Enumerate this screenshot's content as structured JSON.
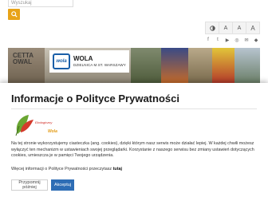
{
  "header": {
    "search": {
      "placeholder": "Wyszukaj"
    },
    "accessibility": {
      "contrast_icon": "contrast-icon",
      "font_sizes": [
        "A",
        "A",
        "A"
      ]
    },
    "social_icons": [
      "facebook-icon",
      "twitter-icon",
      "youtube-icon",
      "instagram-icon",
      "mail-icon",
      "bip-icon"
    ]
  },
  "banner": {
    "stamp_text": "CETTA OWAL",
    "logo_mark": "wola",
    "logo_title": "WOLA",
    "logo_subtitle": "DZIELNICA M.ST. WARSZAWY"
  },
  "cookie_modal": {
    "title": "Informacje o Polityce Prywatności",
    "badge_text": "Ekologiczny",
    "badge_brand": "Wola",
    "body": "Na tej stronie wykorzystujemy ciasteczka (ang. cookies), dzięki którym nasz serwis może działać lepiej. W każdej chwili możesz wyłączyć ten mechanizm w ustawieniach swojej przeglądarki. Korzystanie z naszego serwisu bez zmiany ustawień dotyczących cookies, umieszcza je w pamięci Twojego urządzenia.",
    "more_prefix": "Więcej informacji o Polityce Prywatności przeczytasz",
    "more_link": "tutaj",
    "decline_label": "Przypomnij później",
    "accept_label": "Akceptuj"
  },
  "colors": {
    "accent": "#e8a318",
    "primary": "#2e6db5",
    "logo_blue": "#1a5fa8"
  }
}
